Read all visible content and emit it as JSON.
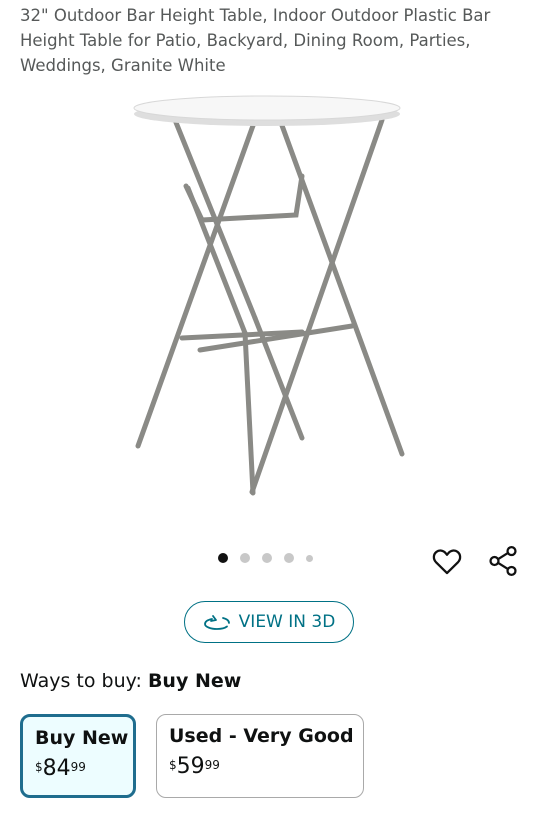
{
  "product": {
    "title": "32\" Outdoor Bar Height Table, Indoor Outdoor Plastic Bar Height Table for Patio, Backyard, Dining Room, Parties, Weddings, Granite White"
  },
  "gallery": {
    "image_count": 5,
    "active_index": 0
  },
  "actions": {
    "wishlist_icon": "heart-outline-icon",
    "share_icon": "share-icon"
  },
  "view3d": {
    "label": "VIEW IN 3D"
  },
  "ways_to_buy": {
    "prefix": "Ways to buy:",
    "selected": "Buy New",
    "options": [
      {
        "label": "Buy New",
        "symbol": "$",
        "whole": "84",
        "fraction": "99"
      },
      {
        "label": "Used - Very Good",
        "symbol": "$",
        "whole": "59",
        "fraction": "99"
      }
    ]
  },
  "colors": {
    "accent": "#007185",
    "selected_border": "#1f6d8e",
    "selected_bg": "#edfdff"
  }
}
